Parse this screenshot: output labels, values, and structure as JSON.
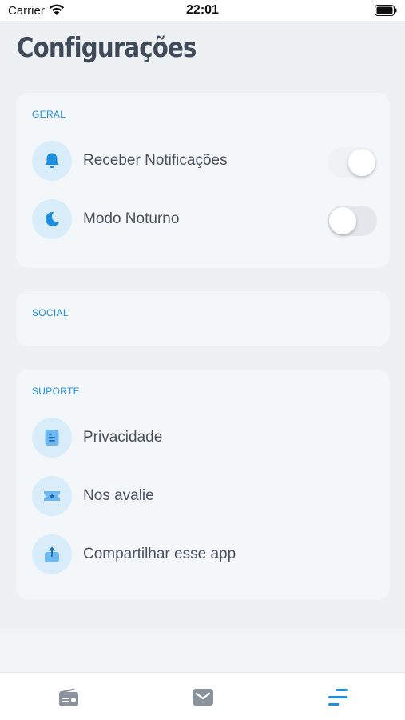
{
  "status_bar": {
    "carrier": "Carrier",
    "time": "22:01"
  },
  "page": {
    "title": "Configurações"
  },
  "sections": {
    "geral": {
      "header": "GERAL",
      "items": [
        {
          "label": "Receber Notificações",
          "icon": "bell-icon",
          "toggle_on": true
        },
        {
          "label": "Modo Noturno",
          "icon": "moon-icon",
          "toggle_on": false
        }
      ]
    },
    "social": {
      "header": "SOCIAL",
      "items": []
    },
    "suporte": {
      "header": "SUPORTE",
      "items": [
        {
          "label": "Privacidade",
          "icon": "document-icon"
        },
        {
          "label": "Nos avalie",
          "icon": "rating-ticket-icon"
        },
        {
          "label": "Compartilhar esse app",
          "icon": "share-icon"
        }
      ]
    }
  },
  "tab_bar": {
    "tabs": [
      {
        "icon": "radio-icon",
        "active": false
      },
      {
        "icon": "mail-icon",
        "active": false
      },
      {
        "icon": "settings-lines-icon",
        "active": true
      }
    ]
  },
  "colors": {
    "accent": "#1e8fe0",
    "icon_bg": "#d8ecfa",
    "card_bg": "#f4f7f9",
    "page_bg": "#eef1f4",
    "title": "#3f4a5a"
  }
}
